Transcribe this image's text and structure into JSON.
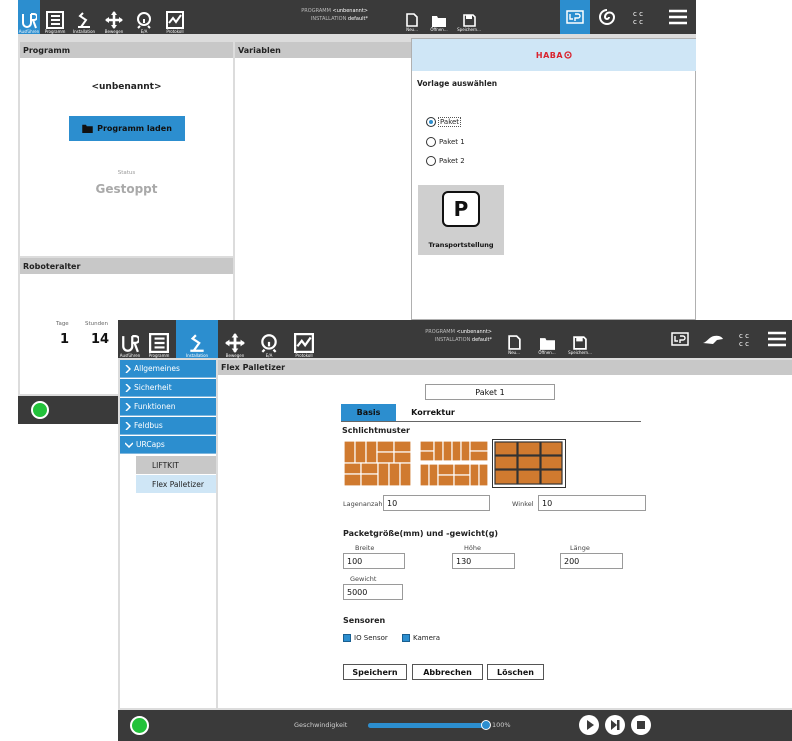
{
  "back": {
    "nav": [
      {
        "label": "Ausführen"
      },
      {
        "label": "Programm"
      },
      {
        "label": "Installation"
      },
      {
        "label": "Bewegen"
      },
      {
        "label": "E/A"
      },
      {
        "label": "Protokoll"
      }
    ],
    "program_label": "PROGRAMM",
    "program_value": "<unbenannt>",
    "installation_label": "INSTALLATION",
    "installation_value": "default*",
    "file_buttons": [
      {
        "label": "Neu..."
      },
      {
        "label": "Öffnen..."
      },
      {
        "label": "Speichern..."
      }
    ],
    "program_panel": {
      "title": "Programm",
      "name": "<unbenannt>",
      "load_button": "Programm laden",
      "status_label": "Status",
      "status_value": "Gestoppt"
    },
    "variables_title": "Variablen",
    "robot_age": {
      "title": "Roboteralter",
      "days_label": "Tage",
      "days_value": "1",
      "hours_label": "Stunden",
      "hours_value": "14"
    }
  },
  "dialog": {
    "brand": "HABA",
    "title": "Vorlage auswählen",
    "options": [
      {
        "label": "Paket",
        "selected": true
      },
      {
        "label": "Paket 1",
        "selected": false
      },
      {
        "label": "Paket 2",
        "selected": false
      }
    ],
    "transport_icon": "P",
    "transport_label": "Transportstellung"
  },
  "front": {
    "nav": [
      {
        "label": "Ausführen"
      },
      {
        "label": "Programm"
      },
      {
        "label": "Installation"
      },
      {
        "label": "Bewegen"
      },
      {
        "label": "E/A"
      },
      {
        "label": "Protokoll"
      }
    ],
    "program_label": "PROGRAMM",
    "program_value": "<unbenannt>",
    "installation_label": "INSTALLATION",
    "installation_value": "default*",
    "file_buttons": [
      {
        "label": "Neu..."
      },
      {
        "label": "Öffnen..."
      },
      {
        "label": "Speichern..."
      }
    ],
    "sidebar": [
      {
        "label": "Allgemeines"
      },
      {
        "label": "Sicherheit"
      },
      {
        "label": "Funktionen"
      },
      {
        "label": "Feldbus"
      },
      {
        "label": "URCaps"
      }
    ],
    "sidebar_sub": [
      {
        "label": "LIFTKIT"
      },
      {
        "label": "Flex Palletizer"
      }
    ],
    "content_title": "Flex Palletizer",
    "package_name": "Paket 1",
    "tabs": [
      {
        "label": "Basis"
      },
      {
        "label": "Korrektur"
      }
    ],
    "pattern_title": "Schlichtmuster",
    "layers_label": "Lagenanzahl",
    "layers_value": "10",
    "angle_label": "Winkel",
    "angle_value": "10",
    "size_title": "Packetgröße(mm) und -gewicht(g)",
    "width_label": "Breite",
    "width_value": "100",
    "height_label": "Höhe",
    "height_value": "130",
    "length_label": "Länge",
    "length_value": "200",
    "weight_label": "Gewicht",
    "weight_value": "5000",
    "sensors_title": "Sensoren",
    "sensor_io": "IO Sensor",
    "sensor_camera": "Kamera",
    "save_button": "Speichern",
    "cancel_button": "Abbrechen",
    "delete_button": "Löschen",
    "speed_label": "Geschwindigkeit",
    "speed_value": "100%",
    "speed_fraction": 1.0
  },
  "colors": {
    "accent": "#2c8ecf",
    "topbar": "#3a3a3a",
    "status_ok": "#22c23a",
    "brand_red": "#d9232e"
  }
}
